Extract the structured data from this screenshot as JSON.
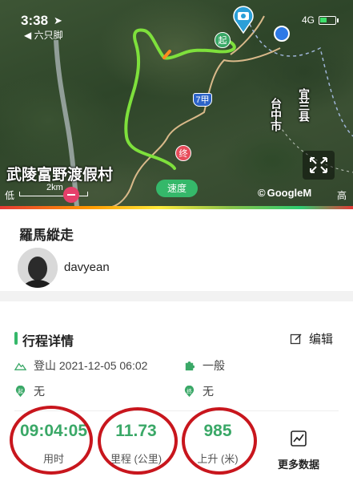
{
  "status_bar": {
    "time": "3:38",
    "carrier_sub": "六只脚",
    "network": "4G"
  },
  "map": {
    "place_label": "武陵富野渡假村",
    "start_pin": "起",
    "end_pin": "终",
    "road_number": "7甲",
    "region_labels": [
      "宜兰县",
      "台中市"
    ],
    "speed_button": "速度",
    "scale_low": "低",
    "scale_high": "高",
    "scale_distance": "2km",
    "attribution": "GoogleM"
  },
  "route": {
    "name": "羅馬縱走",
    "username": "davyean"
  },
  "details": {
    "title": "行程详情",
    "edit_label": "编辑",
    "activity": "登山 2021-12-05 06:02",
    "difficulty": "一般",
    "start_point": "无",
    "end_point": "无"
  },
  "stats": {
    "duration_value": "09:04:05",
    "duration_label": "用时",
    "distance_value": "11.73",
    "distance_label": "里程 (公里)",
    "ascent_value": "985",
    "ascent_label": "上升 (米)",
    "more_label": "更多数据"
  },
  "colors": {
    "accent_green": "#35b86a",
    "annotation_red": "#c8161d",
    "start_pin": "#3aa867",
    "end_pin": "#e74c5a"
  }
}
